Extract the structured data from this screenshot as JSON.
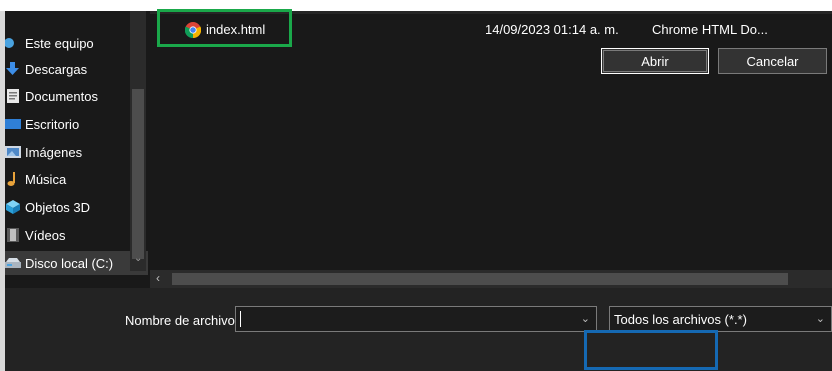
{
  "nav": {
    "items": [
      {
        "label": "Este equipo",
        "icon": "computer-icon"
      },
      {
        "label": "Descargas",
        "icon": "download-arrow-icon"
      },
      {
        "label": "Documentos",
        "icon": "document-icon"
      },
      {
        "label": "Escritorio",
        "icon": "desktop-icon"
      },
      {
        "label": "Imágenes",
        "icon": "image-icon"
      },
      {
        "label": "Música",
        "icon": "music-note-icon"
      },
      {
        "label": "Objetos 3D",
        "icon": "cube-3d-icon"
      },
      {
        "label": "Vídeos",
        "icon": "film-icon"
      },
      {
        "label": "Disco local (C:)",
        "icon": "drive-icon"
      }
    ]
  },
  "files": [
    {
      "name": "index.html",
      "date": "14/09/2023 01:14 a. m.",
      "type": "Chrome HTML Do...",
      "icon": "chrome-icon"
    }
  ],
  "footer": {
    "filename_label": "Nombre de archivo:",
    "filename_value": "",
    "filetype_value": "Todos los archivos (*.*)",
    "open_label": "Abrir",
    "cancel_label": "Cancelar"
  },
  "colors": {
    "highlight_file": "#1aa84a",
    "highlight_open": "#1569b3"
  }
}
